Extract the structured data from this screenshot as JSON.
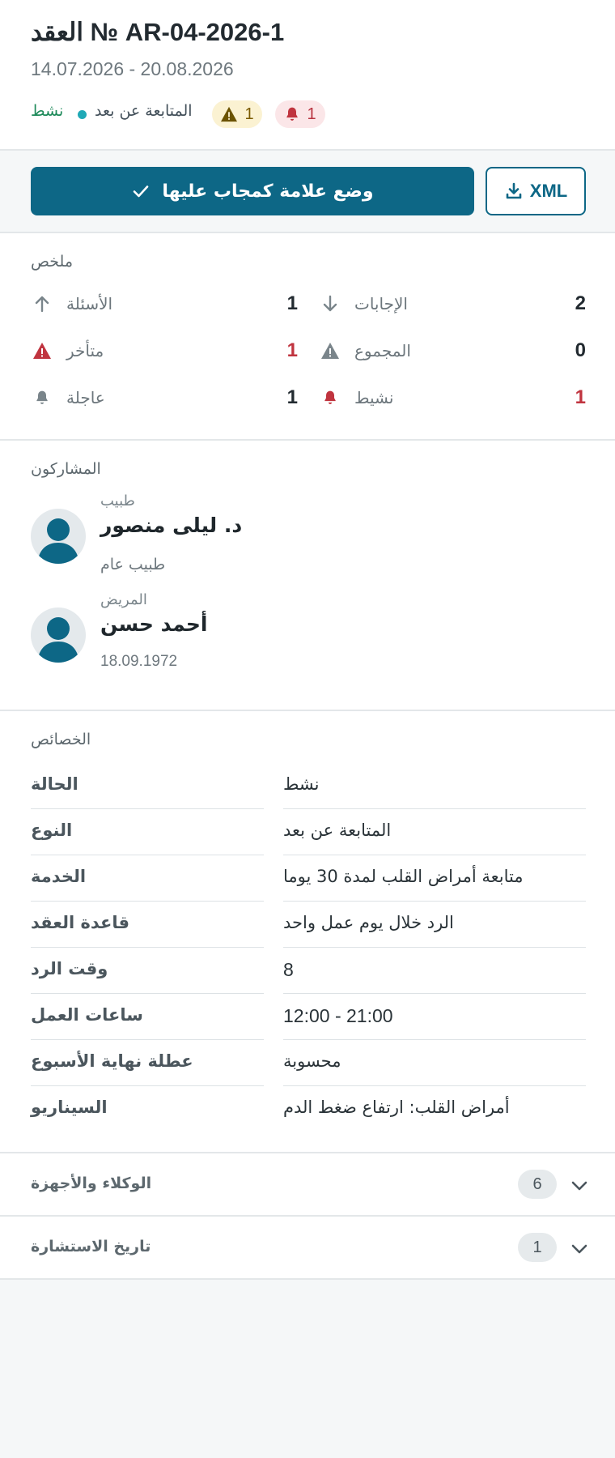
{
  "header": {
    "title": "العقد № AR-04-2026-1",
    "dates": "14.07.2026 - 20.08.2026",
    "alerts_count": "1",
    "warnings_count": "1",
    "type": "المتابعة عن بعد",
    "status": "نشط"
  },
  "actions": {
    "primary_label": "وضع علامة كمجاب عليها",
    "xml_label": "XML"
  },
  "summary": {
    "title": "ملخص",
    "items": [
      {
        "label": "الإجابات",
        "value": "2",
        "icon": "arrow-down-icon"
      },
      {
        "label": "الأسئلة",
        "value": "1",
        "icon": "arrow-up-icon"
      },
      {
        "label": "المجموع",
        "value": "0",
        "icon": "warning-icon"
      },
      {
        "label": "متأخر",
        "value": "1",
        "icon": "warning-icon"
      },
      {
        "label": "نشيط",
        "value": "1",
        "icon": "bell-icon"
      },
      {
        "label": "عاجلة",
        "value": "1",
        "icon": "bell-icon"
      }
    ]
  },
  "participants": {
    "title": "المشاركون",
    "doctor": {
      "role": "طبيب",
      "name": "د. ليلى منصور",
      "subtitle": "طبيب عام"
    },
    "patient": {
      "role": "المريض",
      "name": "أحمد حسن",
      "subtitle": "18.09.1972"
    }
  },
  "properties": {
    "title": "الخصائص",
    "rows": [
      {
        "key": "الحالة",
        "value": "نشط"
      },
      {
        "key": "النوع",
        "value": "المتابعة عن بعد"
      },
      {
        "key": "الخدمة",
        "value": "متابعة أمراض القلب لمدة 30 يوما"
      },
      {
        "key": "قاعدة العقد",
        "value": "الرد خلال يوم عمل واحد"
      },
      {
        "key": "وقت الرد",
        "value": "8"
      },
      {
        "key": "ساعات العمل",
        "value": "12:00 - 21:00"
      },
      {
        "key": "عطلة نهاية الأسبوع",
        "value": "محسوبة"
      },
      {
        "key": "السيناريو",
        "value": "أمراض القلب: ارتفاع ضغط الدم"
      }
    ]
  },
  "accordions": [
    {
      "label": "الوكلاء والأجهزة",
      "count": "6"
    },
    {
      "label": "تاريخ الاستشارة",
      "count": "1"
    }
  ],
  "colors": {
    "primary": "#0d6786",
    "alert": "#c0343f",
    "warning": "#7a5a00",
    "status_dot": "#20a9b6",
    "status_text": "#1e8a5a"
  }
}
